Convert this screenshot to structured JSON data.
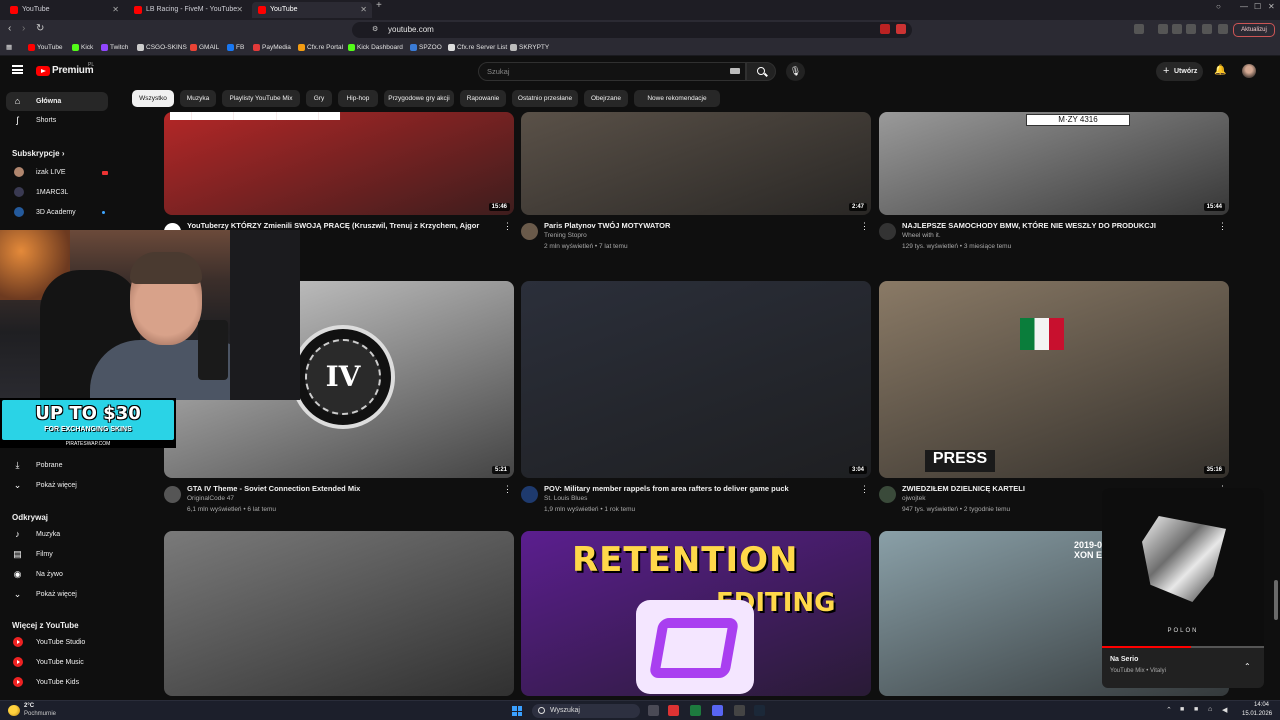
{
  "browser": {
    "tabs": [
      {
        "title": "YouTube",
        "active": false
      },
      {
        "title": "LB Racing - FiveM - YouTube",
        "active": false
      },
      {
        "title": "YouTube",
        "active": true
      }
    ],
    "new_tab": "+",
    "url": "youtube.com",
    "update_button": "Aktualizuj",
    "bookmarks": [
      {
        "label": "YouTube",
        "color": "#ff0000"
      },
      {
        "label": "Kick",
        "color": "#53fc18"
      },
      {
        "label": "Twitch",
        "color": "#9146ff"
      },
      {
        "label": "CSGO-SKINS",
        "color": "#cccccc"
      },
      {
        "label": "GMAIL",
        "color": "#ea4335"
      },
      {
        "label": "FB",
        "color": "#1877f2"
      },
      {
        "label": "PayMedia",
        "color": "#e23a3a"
      },
      {
        "label": "Cfx.re Portal",
        "color": "#f39c12"
      },
      {
        "label": "Kick Dashboard",
        "color": "#53fc18"
      },
      {
        "label": "SPZOO",
        "color": "#3a7bd5"
      },
      {
        "label": "Cfx.re Server List",
        "color": "#dddddd"
      },
      {
        "label": "SKRYPTY",
        "color": "#bbbbbb"
      }
    ]
  },
  "header": {
    "logo_text": "Premium",
    "country_code": "PL",
    "search_placeholder": "Szukaj",
    "create_label": "Utwórz"
  },
  "chips": [
    "Wszystko",
    "Muzyka",
    "Playlisty YouTube Mix",
    "Gry",
    "Hip-hop",
    "Przygodowe gry akcji",
    "Rapowanie",
    "Ostatnio przesłane",
    "Obejrzane",
    "Nowe rekomendacje"
  ],
  "sidebar": {
    "home": "Główna",
    "shorts": "Shorts",
    "subscriptions_heading": "Subskrypcje",
    "subscriptions": [
      {
        "name": "izak LIVE",
        "badge": "live"
      },
      {
        "name": "1MARC3L",
        "badge": ""
      },
      {
        "name": "3D Academy",
        "badge": "new"
      }
    ],
    "saved": "Pobrane",
    "show_more_1": "Pokaż więcej",
    "explore_heading": "Odkrywaj",
    "explore": [
      "Muzyka",
      "Filmy",
      "Na żywo"
    ],
    "show_more_2": "Pokaż więcej",
    "more_heading": "Więcej z YouTube",
    "more": [
      "YouTube Studio",
      "YouTube Music",
      "YouTube Kids"
    ]
  },
  "promo": {
    "title": "UP TO $30",
    "subtitle": "FOR EXCHANGING SKINS",
    "site": "PIRATESWAP.COM"
  },
  "videos": [
    {
      "title": "YouTuberzy KTÓRZY Zmienili SWOJĄ PRACĘ (Kruszwil, Trenuj z Krzychem, Ajgor",
      "channel": "",
      "stats": "",
      "duration": "15:46",
      "thumb": "#b42727"
    },
    {
      "title": "Paris Platynov TWÓJ MOTYWATOR",
      "channel": "Trening Stopro",
      "stats": "2 mln wyświetleń • 7 lat temu",
      "duration": "2:47",
      "thumb": "#5a5148"
    },
    {
      "title": "NAJLEPSZE SAMOCHODY BMW, KTÓRE NIE WESZŁY DO PRODUKCJI",
      "channel": "Wheel with it.",
      "stats": "129 tys. wyświetleń • 3 miesiące temu",
      "duration": "15:44",
      "thumb": "#9a9a9a"
    },
    {
      "title": "GTA IV Theme - Soviet Connection Extended Mix",
      "channel": "OriginalCode 47",
      "stats": "6,1 mln wyświetleń • 6 lat temu",
      "duration": "5:21",
      "thumb": "#cfcfcf"
    },
    {
      "title": "POV: Military member rappels from area rafters to deliver game puck",
      "channel": "St. Louis Blues",
      "stats": "1,9 mln wyświetleń • 1 rok temu",
      "duration": "3:04",
      "thumb": "#2b2f3a"
    },
    {
      "title": "ZWIEDZIŁEM DZIELNICĘ KARTELI",
      "channel": "ojwojtek",
      "stats": "947 tys. wyświetleń • 2 tygodnie temu",
      "duration": "35:16",
      "thumb": "#8a7a66"
    },
    {
      "title": "",
      "channel": "",
      "stats": "",
      "duration": "",
      "thumb": "#7a7a7a"
    },
    {
      "title": "",
      "channel": "",
      "stats": "",
      "duration": "",
      "thumb": "#5b1e8f"
    },
    {
      "title": "",
      "channel": "",
      "stats": "",
      "duration": "",
      "thumb": "#8aa0a8"
    }
  ],
  "thumb_text": {
    "gta": "IV",
    "retention_1": "RETENTION",
    "retention_2": "EDITING",
    "press": "PRESS",
    "plate": "M·ZY 4316",
    "date_overlay": "2019-0",
    "date_overlay_2": "XON E"
  },
  "miniplayer": {
    "title": "Na Serio",
    "subtitle": "YouTube Mix • Vitalyi",
    "art_label": "POLON",
    "progress": 0.55
  },
  "taskbar": {
    "temperature": "2°C",
    "weather": "Pochmurnie",
    "search_placeholder": "Wyszukaj",
    "time": "14:04",
    "date": "15.01.2026"
  }
}
